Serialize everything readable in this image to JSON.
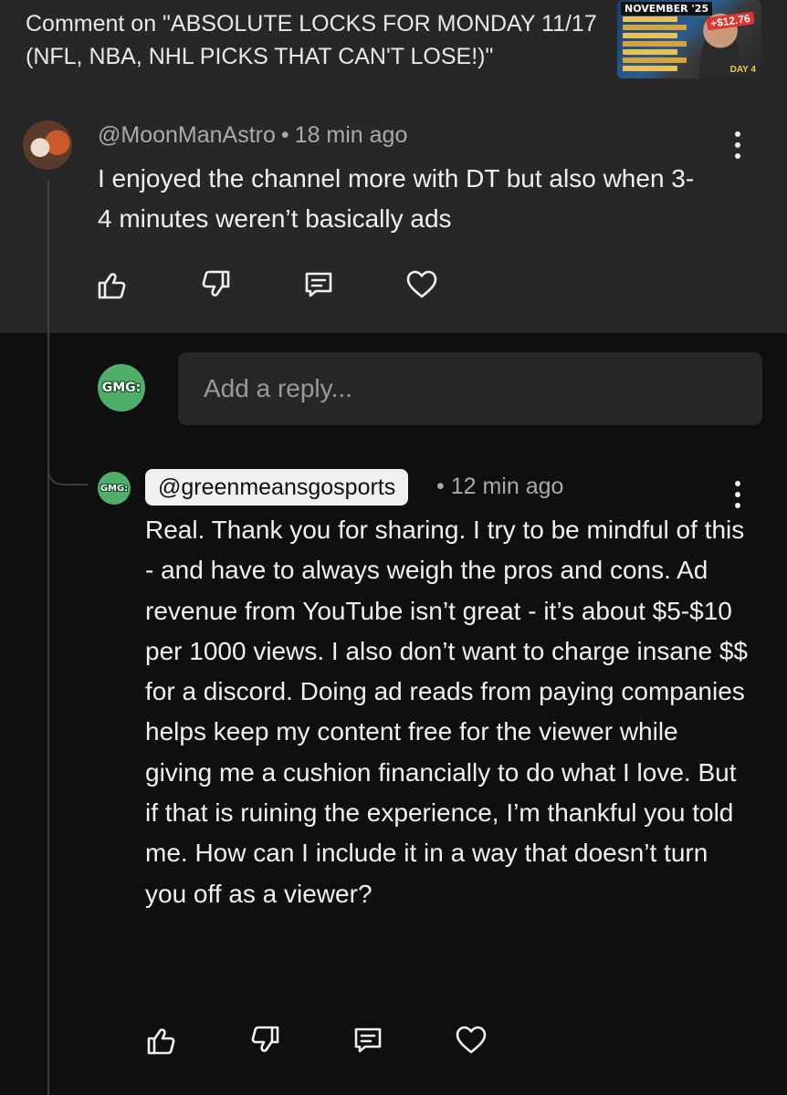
{
  "header": {
    "title": "Comment on \"ABSOLUTE LOCKS FOR MONDAY 11/17 (NFL, NBA, NHL PICKS THAT CAN'T LOSE!)\"",
    "thumbnail": {
      "tag": "NOVEMBER '25",
      "amount": "+$12.76",
      "badge": "DAY 4"
    }
  },
  "comment": {
    "author": "@MoonManAstro",
    "separator": "•",
    "time": "18 min ago",
    "body": "I enjoyed the channel more with DT but also when 3-4 minutes weren’t basically ads",
    "actions": [
      "thumbs-up-icon",
      "thumbs-down-icon",
      "reply-icon",
      "heart-icon"
    ]
  },
  "reply_box": {
    "avatar_text": "GMG:",
    "placeholder": "Add a reply..."
  },
  "reply": {
    "avatar_text": "GMG:",
    "author": "@greenmeansgosports",
    "separator": "•",
    "time": "12 min ago",
    "body": "Real. Thank you for sharing. I try to be mindful of this - and have to always weigh the pros and cons. Ad revenue from YouTube isn’t great - it’s about $5-$10 per 1000 views. I also don’t want to charge insane $$ for a discord. Doing ad reads from paying companies helps keep my content free for the viewer while giving me a cushion financially to do what I love. But if that is ruining the experience, I’m thankful you told me. How can I include it in a way that doesn’t turn you off as a viewer?",
    "actions": [
      "thumbs-up-icon",
      "thumbs-down-icon",
      "reply-icon",
      "heart-icon"
    ]
  },
  "colors": {
    "top_bg": "#272727",
    "page_bg": "#0f0f0f",
    "gmg_green": "#4fae6a"
  }
}
